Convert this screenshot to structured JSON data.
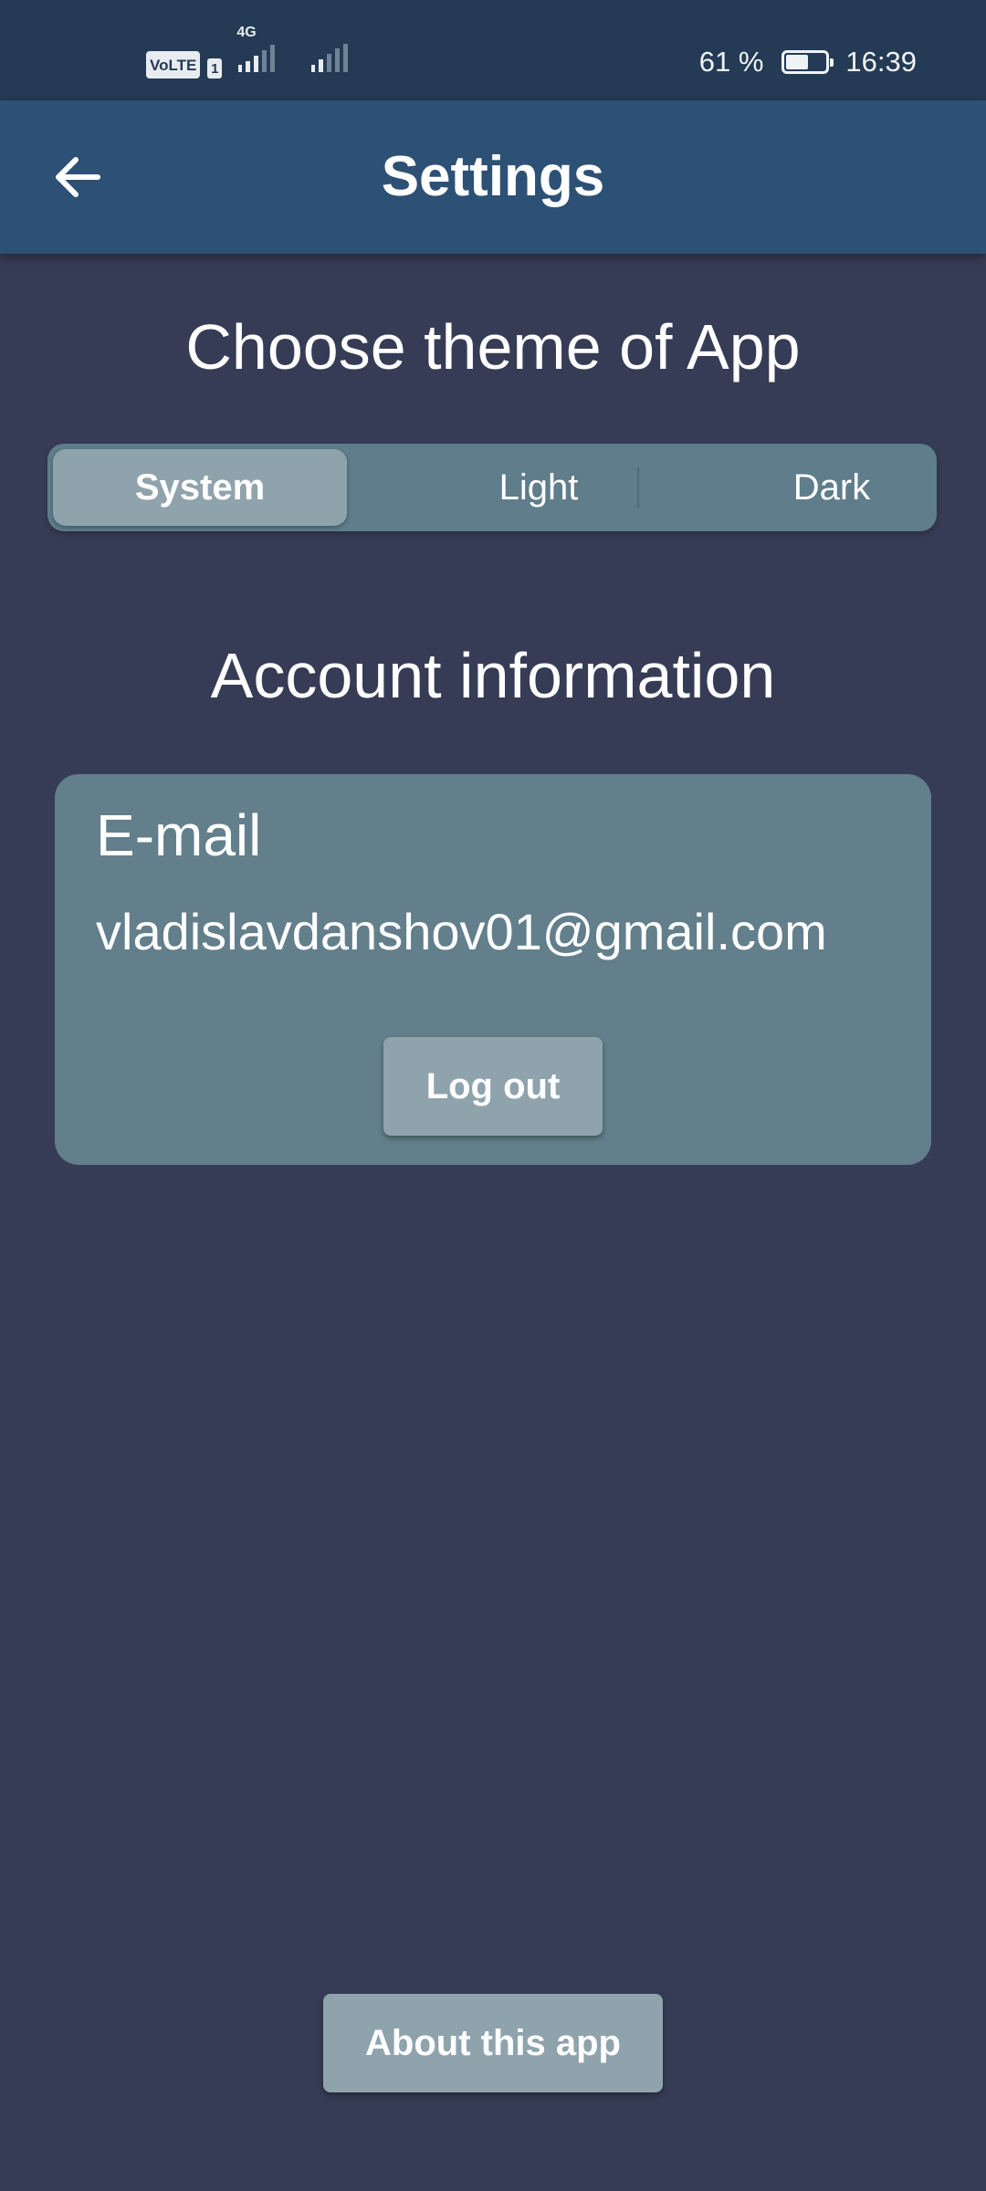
{
  "status_bar": {
    "volte_label": "VoLTE",
    "volte_sim": "1",
    "network_type": "4G",
    "battery_percent_text": "61 %",
    "battery_level": 0.61,
    "time": "16:39"
  },
  "app_bar": {
    "back_icon": "arrow-left-icon",
    "title": "Settings"
  },
  "theme": {
    "heading": "Choose theme of App",
    "options": [
      "System",
      "Light",
      "Dark"
    ],
    "selected": "System"
  },
  "account": {
    "heading": "Account information",
    "email_label": "E-mail",
    "email_value": "vladislavdanshov01@gmail.com",
    "logout_label": "Log out"
  },
  "about_label": "About this app",
  "colors": {
    "background": "#363c55",
    "status_bar": "#243a55",
    "app_bar": "#2d5075",
    "card": "#627f8b",
    "button": "#8fa3ad",
    "segmented_track": "#5f7d8b"
  }
}
